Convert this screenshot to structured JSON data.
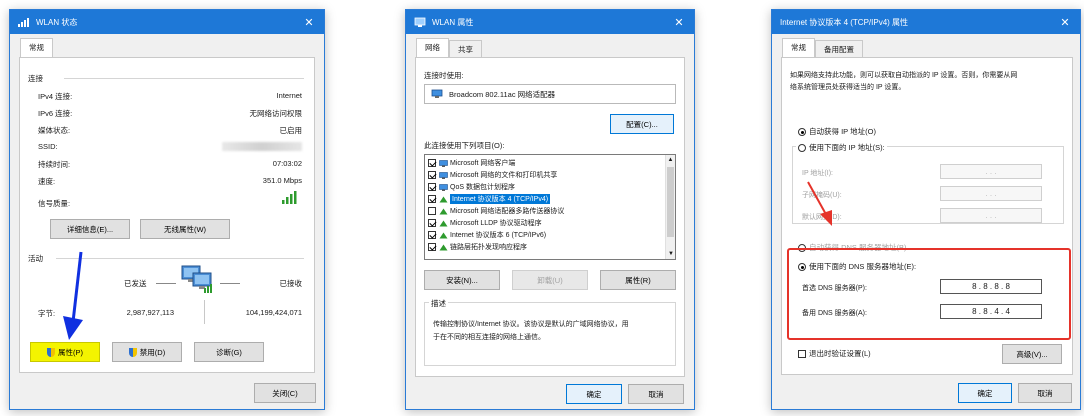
{
  "dialog1": {
    "title": "WLAN 状态",
    "tabs": [
      "常规"
    ],
    "connection_header": "连接",
    "rows": [
      {
        "label": "IPv4 连接:",
        "value": "Internet"
      },
      {
        "label": "IPv6 连接:",
        "value": "无网络访问权限"
      },
      {
        "label": "媒体状态:",
        "value": "已启用"
      },
      {
        "label": "SSID:",
        "value": ""
      },
      {
        "label": "持续时间:",
        "value": "07:03:02"
      },
      {
        "label": "速度:",
        "value": "351.0 Mbps"
      }
    ],
    "signal_label": "信号质量:",
    "details_button": "详细信息(E)...",
    "wireless_button": "无线属性(W)",
    "activity_header": "活动",
    "sent_label": "已发送",
    "received_label": "已接收",
    "bytes_label": "字节:",
    "bytes_sent": "2,987,927,113",
    "bytes_received": "104,199,424,071",
    "properties_button": "属性(P)",
    "disable_button": "禁用(D)",
    "diagnose_button": "诊断(G)",
    "close_button": "关闭(C)"
  },
  "dialog2": {
    "title": "WLAN 属性",
    "tabs": [
      "网络",
      "共享"
    ],
    "connect_using_label": "连接时使用:",
    "adapter_name": "Broadcom 802.11ac 网络适配器",
    "configure_button": "配置(C)...",
    "items_label": "此连接使用下列项目(O):",
    "items": [
      {
        "label": "Microsoft 网络客户端",
        "checked": true,
        "selected": false
      },
      {
        "label": "Microsoft 网络的文件和打印机共享",
        "checked": true,
        "selected": false
      },
      {
        "label": "QoS 数据包计划程序",
        "checked": true,
        "selected": false
      },
      {
        "label": "Internet 协议版本 4 (TCP/IPv4)",
        "checked": true,
        "selected": true
      },
      {
        "label": "Microsoft 网络适配器多路传送器协议",
        "checked": false,
        "selected": false
      },
      {
        "label": "Microsoft LLDP 协议驱动程序",
        "checked": true,
        "selected": false
      },
      {
        "label": "Internet 协议版本 6 (TCP/IPv6)",
        "checked": true,
        "selected": false
      },
      {
        "label": "链路层拓扑发现响应程序",
        "checked": true,
        "selected": false
      }
    ],
    "install_button": "安装(N)...",
    "uninstall_button": "卸载(U)",
    "properties_button": "属性(R)",
    "description_header": "描述",
    "description_text_1": "传输控制协议/Internet 协议。该协议是默认的广域网络协议，用",
    "description_text_2": "于在不同的相互连接的网络上通信。",
    "ok_button": "确定",
    "cancel_button": "取消"
  },
  "dialog3": {
    "title": "Internet 协议版本 4 (TCP/IPv4) 属性",
    "tabs": [
      "常规",
      "备用配置"
    ],
    "intro_1": "如果网络支持此功能，则可以获取自动指派的 IP 设置。否则，你需要从网",
    "intro_2": "络系统管理员处获得适当的 IP 设置。",
    "auto_ip": "自动获得 IP 地址(O)",
    "manual_ip": "使用下面的 IP 地址(S):",
    "ip_address_label": "IP 地址(I):",
    "subnet_label": "子网掩码(U):",
    "gateway_label": "默认网关(D):",
    "empty_ip": ".     .     .",
    "auto_dns": "自动获得 DNS 服务器地址(B)",
    "manual_dns": "使用下面的 DNS 服务器地址(E):",
    "preferred_dns_label": "首选 DNS 服务器(P):",
    "preferred_dns_value": "8 . 8 . 8 . 8",
    "alternate_dns_label": "备用 DNS 服务器(A):",
    "alternate_dns_value": "8 . 8 . 4 . 4",
    "validate_label": "退出时验证设置(L)",
    "advanced_button": "高级(V)...",
    "ok_button": "确定",
    "cancel_button": "取消"
  },
  "colors": {
    "titlebar": "#1e78d7",
    "highlight_yellow": "#f4f400",
    "arrow_blue": "#1030e0",
    "annotation_red": "#e5332a",
    "selection": "#0078d7"
  }
}
